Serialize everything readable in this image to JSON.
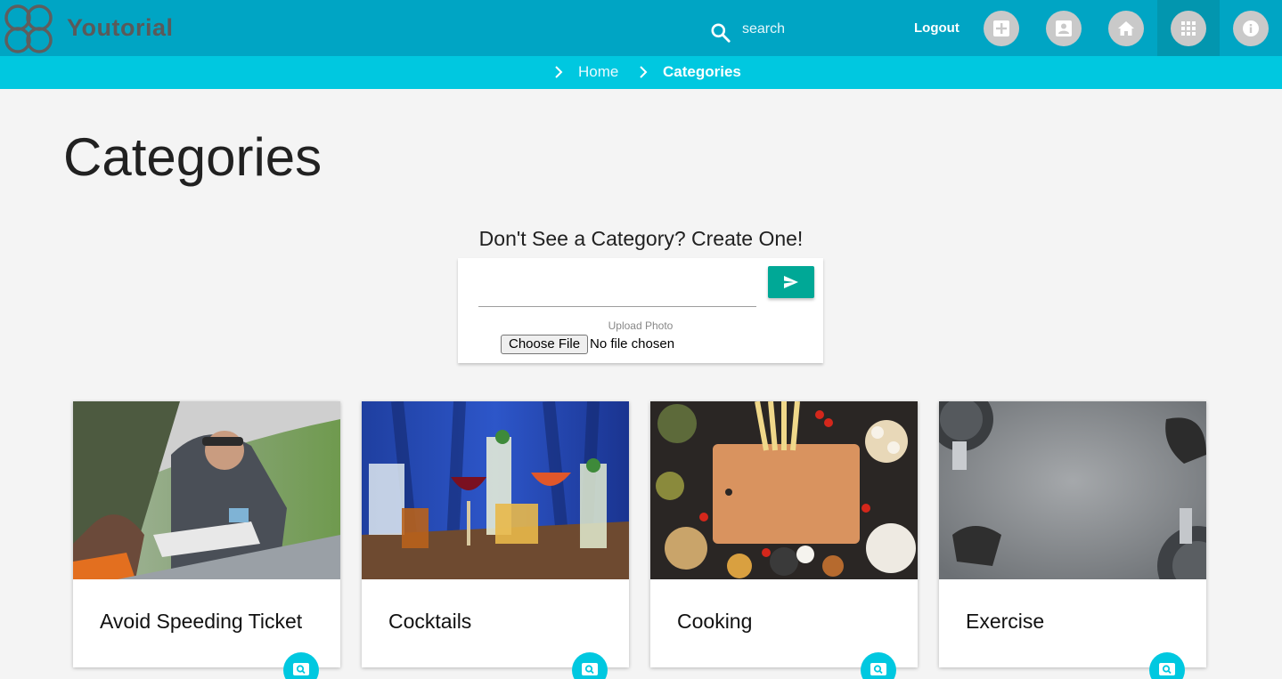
{
  "header": {
    "brand": "Youtorial",
    "search_placeholder": "search",
    "logout_label": "Logout",
    "nav_icons": [
      "add-box-icon",
      "account-box-icon",
      "home-icon",
      "apps-grid-icon",
      "info-icon"
    ],
    "active_nav": "apps-grid-icon"
  },
  "breadcrumb": {
    "items": [
      "Home",
      "Categories"
    ]
  },
  "page": {
    "title": "Categories"
  },
  "create": {
    "heading": "Don't See a Category? Create One!",
    "input_value": "",
    "upload_label": "Upload Photo",
    "choose_file_label": "Choose File",
    "file_status": "No file chosen"
  },
  "categories": [
    {
      "name": "Avoid Speeding Ticket"
    },
    {
      "name": "Cocktails"
    },
    {
      "name": "Cooking"
    },
    {
      "name": "Exercise"
    }
  ],
  "colors": {
    "header": "#00a5c4",
    "breadcrumb_bar": "#00c8e0",
    "send_button": "#00a896",
    "fab": "#00c8e0"
  }
}
